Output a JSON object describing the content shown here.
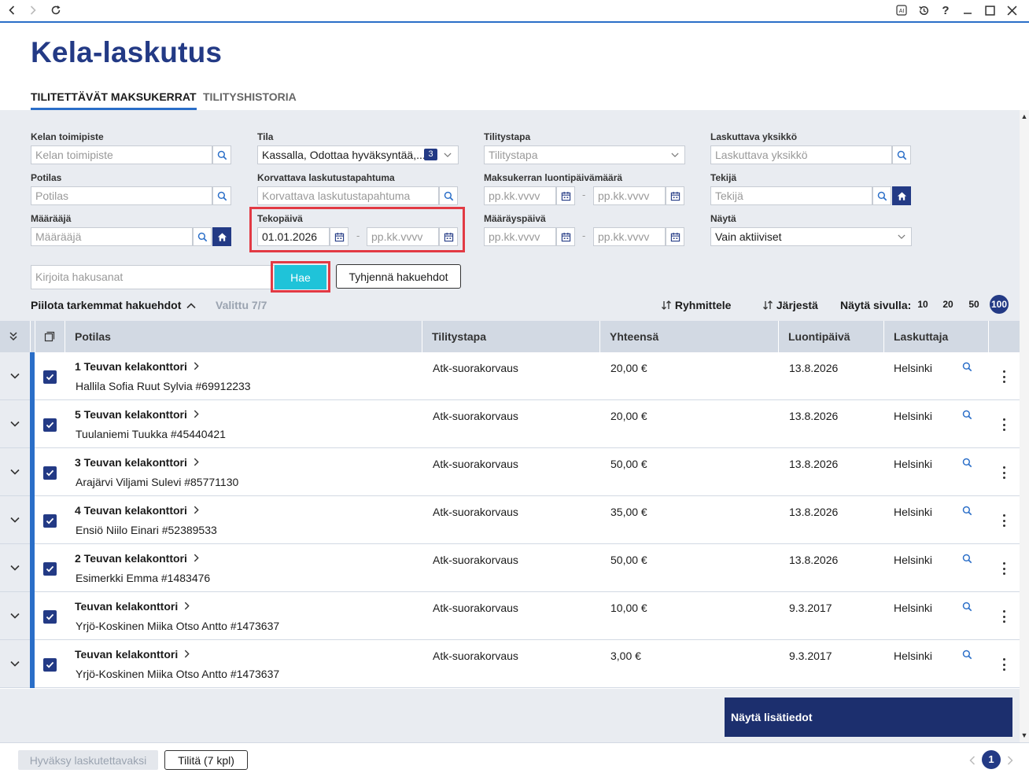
{
  "window": {
    "icons": [
      "back-icon",
      "forward-icon",
      "refresh-icon",
      "ai-icon",
      "history-icon",
      "help-icon",
      "maximize-icon",
      "close-icon"
    ],
    "help_glyph": "?"
  },
  "page_title": "Kela-laskutus",
  "tabs": [
    {
      "label": "TILITETTÄVÄT MAKSUKERRAT",
      "active": true
    },
    {
      "label": "TILITYSHISTORIA",
      "active": false
    }
  ],
  "filters": {
    "kelan_toimipiste": {
      "label": "Kelan toimipiste",
      "placeholder": "Kelan toimipiste"
    },
    "tila": {
      "label": "Tila",
      "value": "Kassalla, Odottaa hyväksyntää,...",
      "count": "3"
    },
    "tilitystapa": {
      "label": "Tilitystapa",
      "placeholder": "Tilitystapa"
    },
    "laskuttava_yksikko": {
      "label": "Laskuttava yksikkö",
      "placeholder": "Laskuttava yksikkö"
    },
    "potilas": {
      "label": "Potilas",
      "placeholder": "Potilas"
    },
    "korvattava": {
      "label": "Korvattava laskutustapahtuma",
      "placeholder": "Korvattava laskutustapahtuma"
    },
    "luontipaiva": {
      "label": "Maksukerran luontipäivämäärä",
      "from_placeholder": "pp.kk.vvvv",
      "to_placeholder": "pp.kk.vvvv"
    },
    "tekija": {
      "label": "Tekijä",
      "placeholder": "Tekijä"
    },
    "maaraaja": {
      "label": "Määrääjä",
      "placeholder": "Määrääjä"
    },
    "tekopaiva": {
      "label": "Tekopäivä",
      "from_value": "01.01.2026",
      "to_placeholder": "pp.kk.vvvv"
    },
    "maarayspaiva": {
      "label": "Määräyspäivä",
      "from_placeholder": "pp.kk.vvvv",
      "to_placeholder": "pp.kk.vvvv"
    },
    "nayta": {
      "label": "Näytä",
      "value": "Vain aktiiviset"
    },
    "dash": "-"
  },
  "search": {
    "placeholder": "Kirjoita hakusanat",
    "search_button": "Hae",
    "clear_button": "Tyhjennä hakuehdot"
  },
  "toolbar": {
    "hide_filters": "Piilota tarkemmat hakuehdot",
    "selected": "Valittu 7/7",
    "group": "Ryhmittele",
    "sort": "Järjestä",
    "per_page_label": "Näytä sivulla:",
    "per_page_options": [
      "10",
      "20",
      "50",
      "100"
    ],
    "per_page_selected": "100"
  },
  "table": {
    "columns": [
      "Potilas",
      "Tilitystapa",
      "Yhteensä",
      "Luontipäivä",
      "Laskuttaja"
    ],
    "rows": [
      {
        "office": "1 Teuvan kelakonttori",
        "patient": "Hallila Sofia Ruut Sylvia #69912233",
        "method": "Atk-suorakorvaus",
        "total": "20,00 €",
        "created": "13.8.2026",
        "biller": "Helsinki"
      },
      {
        "office": "5 Teuvan kelakonttori",
        "patient": "Tuulaniemi Tuukka #45440421",
        "method": "Atk-suorakorvaus",
        "total": "20,00 €",
        "created": "13.8.2026",
        "biller": "Helsinki"
      },
      {
        "office": "3 Teuvan kelakonttori",
        "patient": "Arajärvi Viljami Sulevi #85771130",
        "method": "Atk-suorakorvaus",
        "total": "50,00 €",
        "created": "13.8.2026",
        "biller": "Helsinki"
      },
      {
        "office": "4 Teuvan kelakonttori",
        "patient": "Ensiö Niilo Einari #52389533",
        "method": "Atk-suorakorvaus",
        "total": "35,00 €",
        "created": "13.8.2026",
        "biller": "Helsinki"
      },
      {
        "office": "2 Teuvan kelakonttori",
        "patient": "Esimerkki Emma #1483476",
        "method": "Atk-suorakorvaus",
        "total": "50,00 €",
        "created": "13.8.2026",
        "biller": "Helsinki"
      },
      {
        "office": "Teuvan kelakonttori",
        "patient": "Yrjö-Koskinen Miika Otso Antto #1473637",
        "method": "Atk-suorakorvaus",
        "total": "10,00 €",
        "created": "9.3.2017",
        "biller": "Helsinki"
      },
      {
        "office": "Teuvan kelakonttori",
        "patient": "Yrjö-Koskinen Miika Otso Antto #1473637",
        "method": "Atk-suorakorvaus",
        "total": "3,00 €",
        "created": "9.3.2017",
        "biller": "Helsinki"
      }
    ]
  },
  "details_panel": {
    "label": "Näytä lisätiedot"
  },
  "footer": {
    "approve_button": "Hyväksy laskutettavaksi",
    "settle_button": "Tilitä (7 kpl)",
    "current_page": "1"
  },
  "colors": {
    "primary": "#233a85",
    "accent_blue": "#2a6ec8",
    "search_button": "#1fc3d9",
    "highlight": "#e23a44",
    "filter_bg": "#e9ecf1",
    "header_bg": "#d2d9e3"
  }
}
